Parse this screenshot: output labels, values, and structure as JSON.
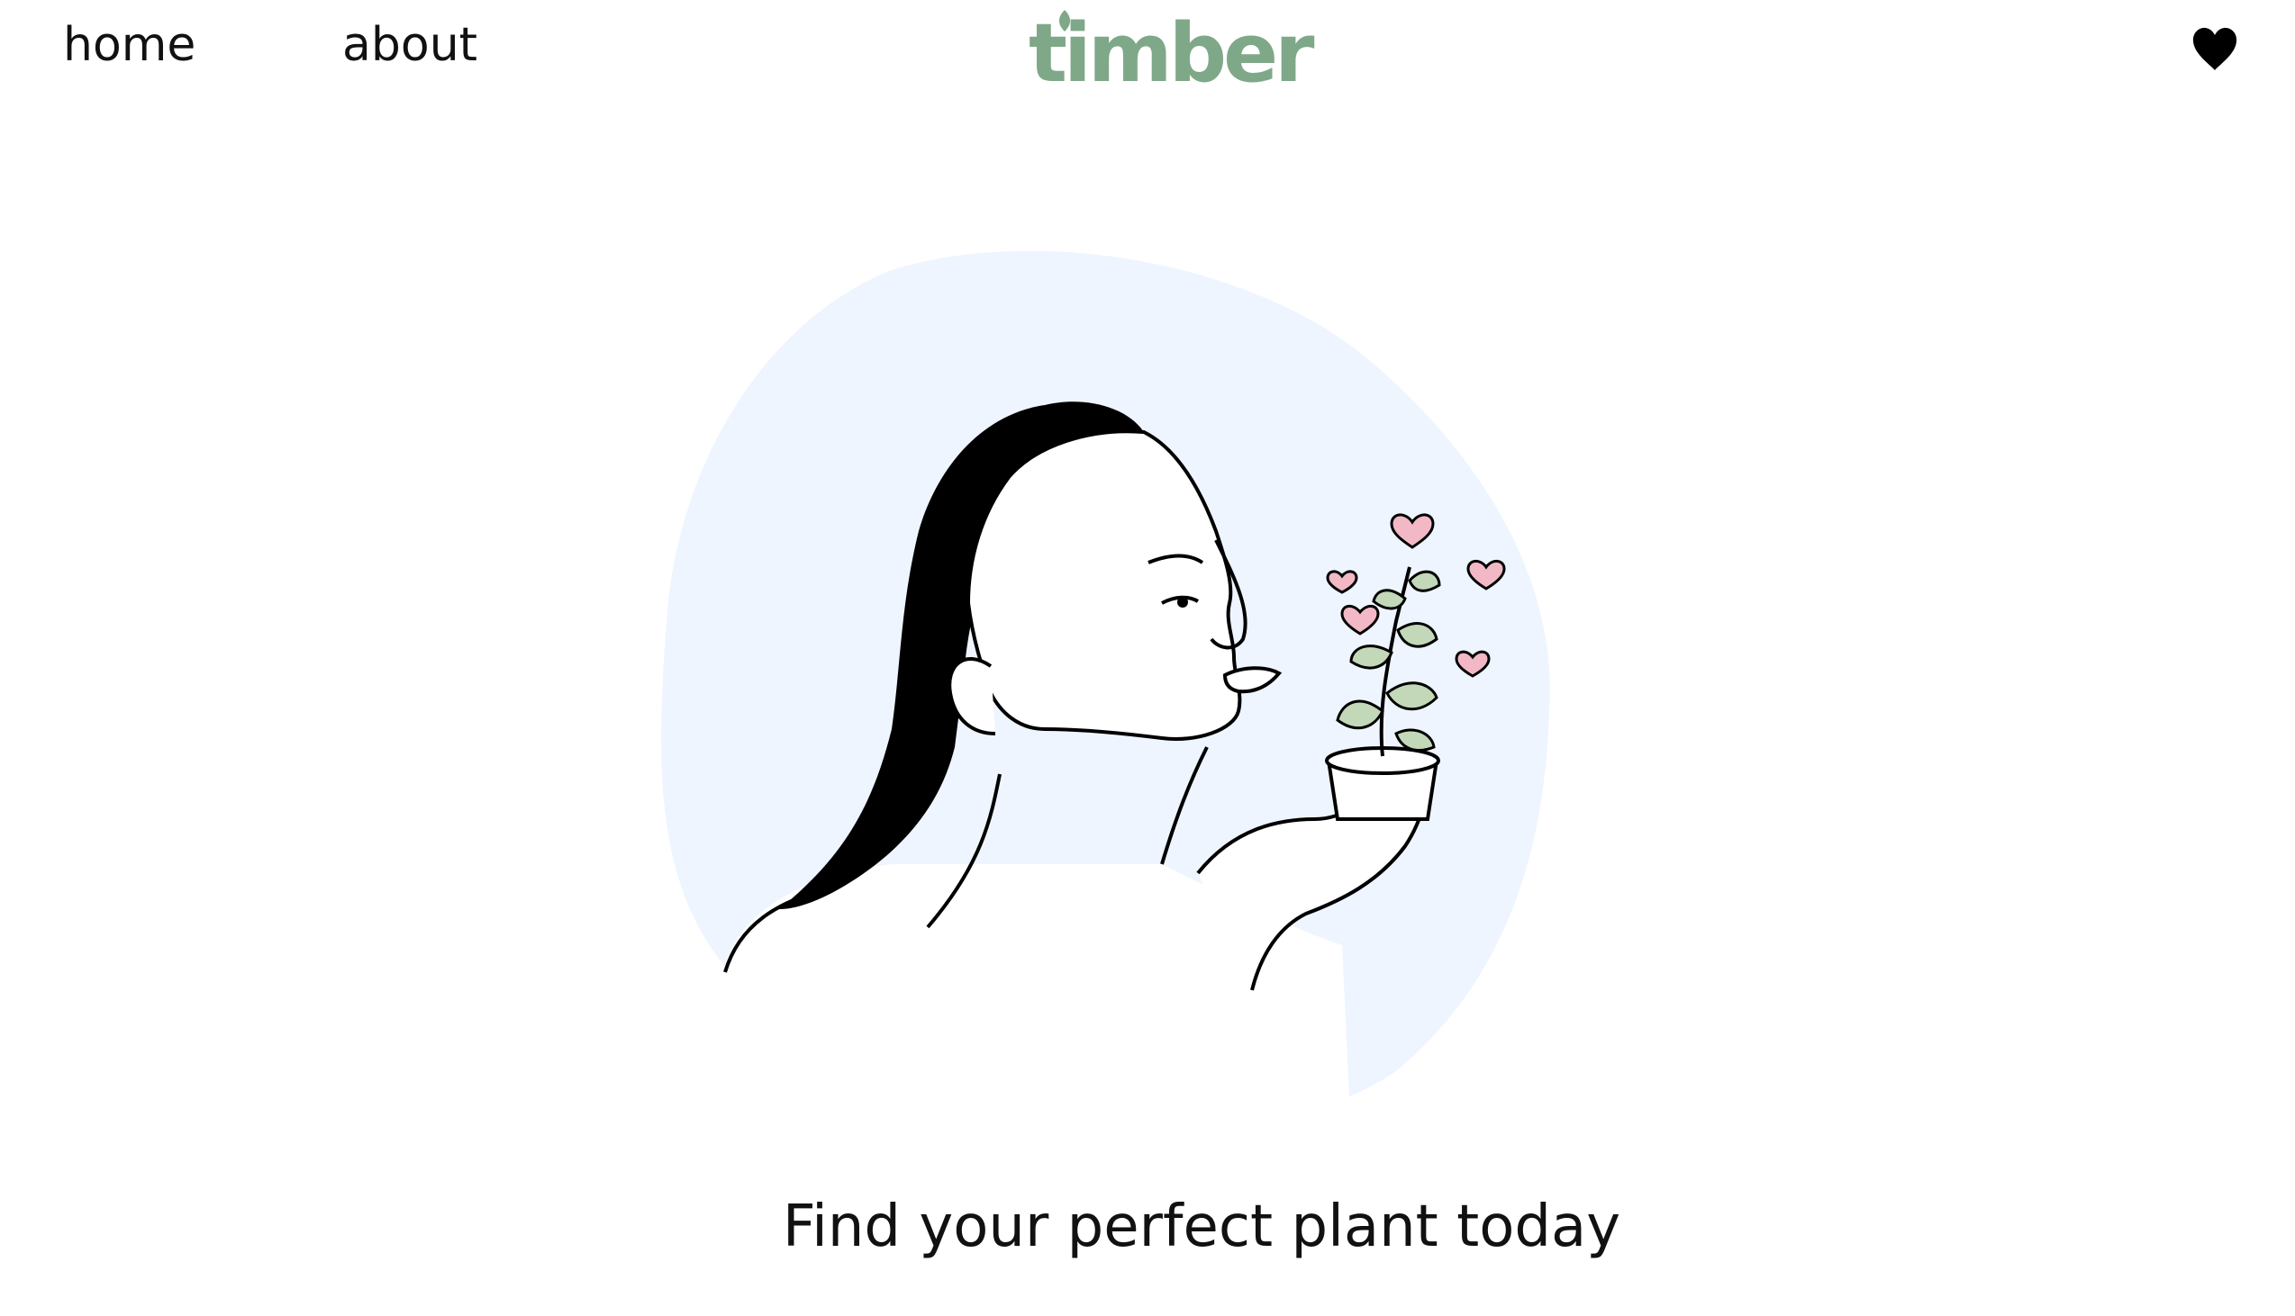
{
  "nav": {
    "home_label": "home",
    "about_label": "about"
  },
  "brand": {
    "logo_text": "timber",
    "logo_color": "#7fa888"
  },
  "header": {
    "favorites_icon": "heart-icon"
  },
  "hero": {
    "illustration": "woman-kissing-potted-plant",
    "backdrop_color": "#eef5fe",
    "heart_color": "#f2b8c6",
    "leaf_color": "#c2d8b8",
    "tagline": "Find your perfect plant today"
  }
}
